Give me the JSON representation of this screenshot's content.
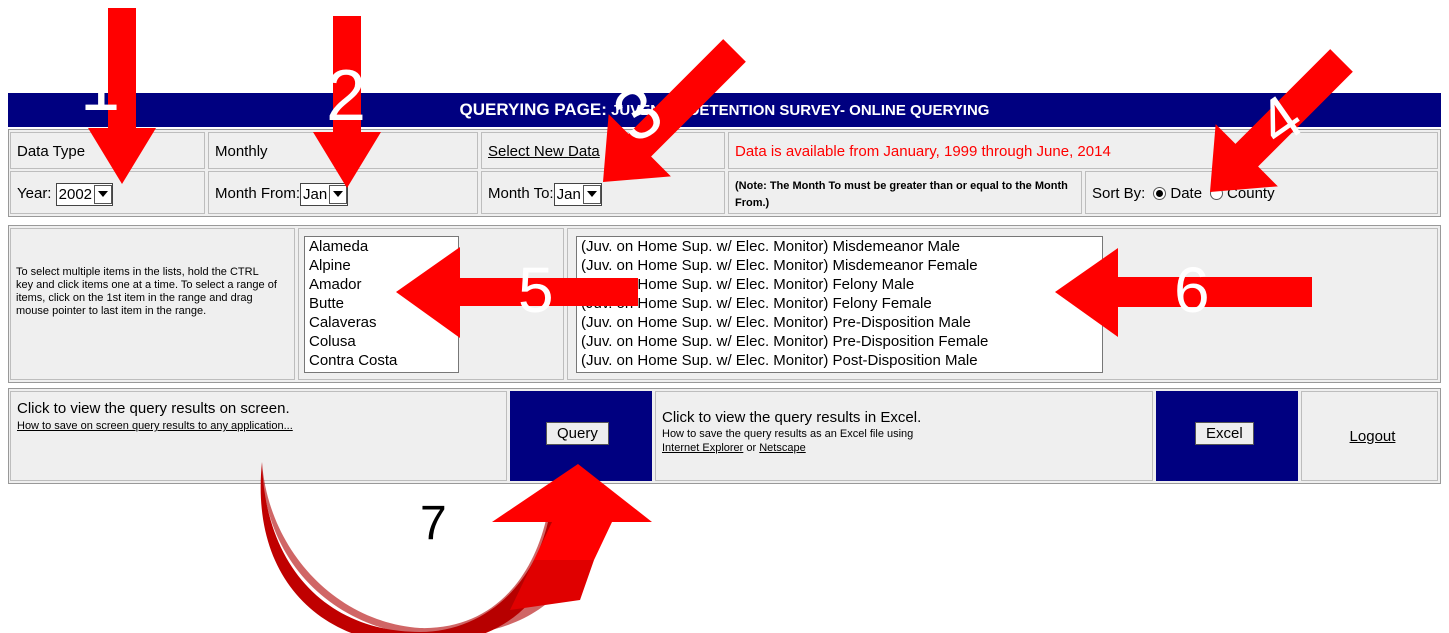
{
  "banner": {
    "title": "QUERYING PAGE:",
    "subtitle": "JUVENILE DETENTION SURVEY- ONLINE QUERYING"
  },
  "row1": {
    "data_type_label": "Data Type",
    "data_type_value": "Monthly",
    "select_new_data_link": "Select New Data",
    "availability_note": "Data is available from January, 1999 through June, 2014"
  },
  "row2": {
    "year_label": "Year:",
    "year_value": "2002",
    "month_from_label": "Month From:",
    "month_from_value": "Jan",
    "month_to_label": "Month To:",
    "month_to_value": "Jan",
    "note": "(Note: The Month To must be greater than or equal to the Month From.)",
    "sort_by_label": "Sort By:",
    "sort_options": [
      "Date",
      "County"
    ],
    "sort_selected": "Date"
  },
  "instructions": "To select multiple items in the lists, hold the CTRL key and click items one at a time. To select a range of items, click on the 1st item in the range and drag mouse pointer to last item in the range.",
  "counties": [
    "Alameda",
    "Alpine",
    "Amador",
    "Butte",
    "Calaveras",
    "Colusa",
    "Contra Costa"
  ],
  "categories": [
    "(Juv. on Home Sup. w/ Elec. Monitor) Misdemeanor Male",
    "(Juv. on Home Sup. w/ Elec. Monitor) Misdemeanor Female",
    "(Juv. on Home Sup. w/ Elec. Monitor) Felony Male",
    "(Juv. on Home Sup. w/ Elec. Monitor) Felony Female",
    "(Juv. on Home Sup. w/ Elec. Monitor) Pre-Disposition Male",
    "(Juv. on Home Sup. w/ Elec. Monitor) Pre-Disposition Female",
    "(Juv. on Home Sup. w/ Elec. Monitor) Post-Disposition Male"
  ],
  "bottom": {
    "screen_text": "Click to view the query results on screen.",
    "screen_link": "How to save on screen query results to any application...",
    "query_button": "Query",
    "excel_text": "Click to view the query results in Excel.",
    "excel_help": "How to save the query results as an Excel file using",
    "ie_link": "Internet Explorer",
    "or_text": "or",
    "netscape_link": "Netscape",
    "excel_button": "Excel",
    "logout_link": "Logout"
  },
  "annotations": {
    "n1": "1",
    "n2": "2",
    "n3": "3",
    "n4": "4",
    "n5": "5",
    "n6": "6",
    "n7": "7"
  },
  "colors": {
    "banner": "#000080",
    "arrow": "#ff0000",
    "curved_arrow_dark": "#c00000",
    "note_red": "#ff0000"
  }
}
